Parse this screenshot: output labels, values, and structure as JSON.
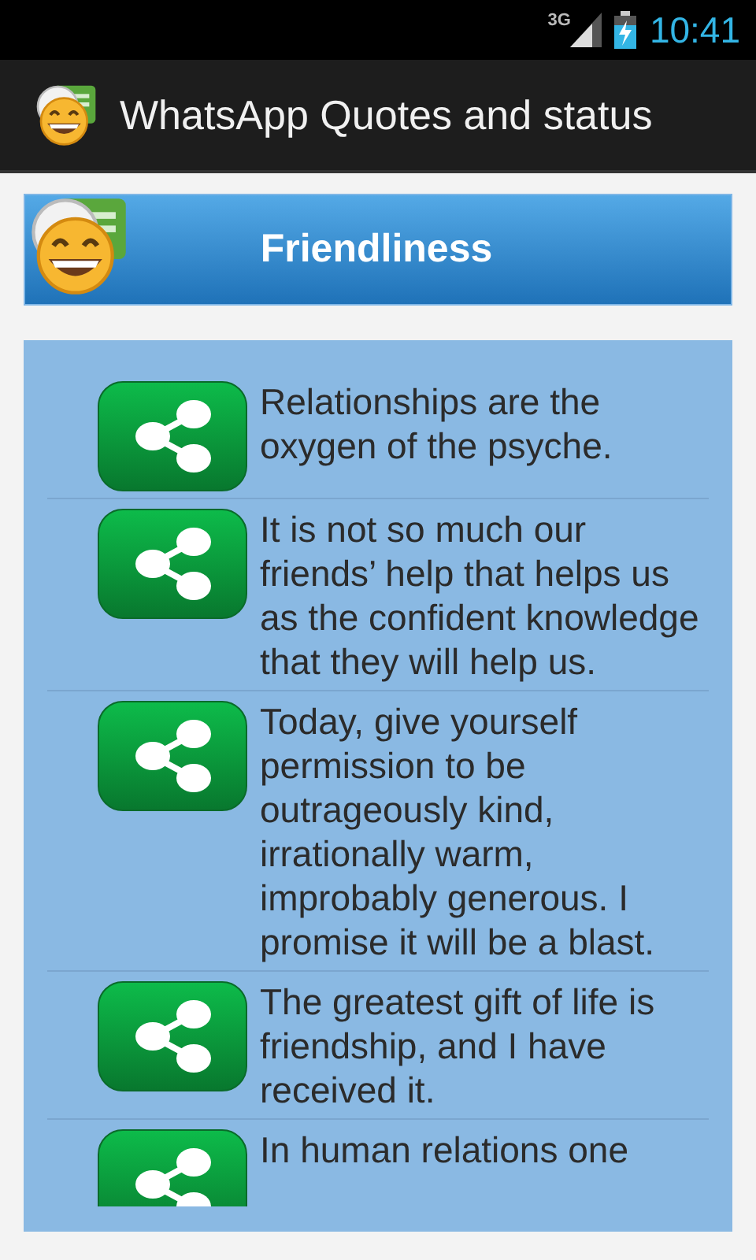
{
  "status_bar": {
    "network": "3G",
    "time": "10:41"
  },
  "app_bar": {
    "title": "WhatsApp Quotes and status"
  },
  "category": {
    "title": "Friendliness"
  },
  "quotes": [
    {
      "text": "Relationships are the oxygen of the psyche."
    },
    {
      "text": "It is not so much our friends’ help that helps us as the confident knowledge that they will help us."
    },
    {
      "text": "Today, give yourself permission to be outrageously kind, irrationally warm, improbably generous. I promise it will be a blast."
    },
    {
      "text": "The greatest gift of life is friendship, and I have received it."
    },
    {
      "text": "In human relations one"
    }
  ]
}
